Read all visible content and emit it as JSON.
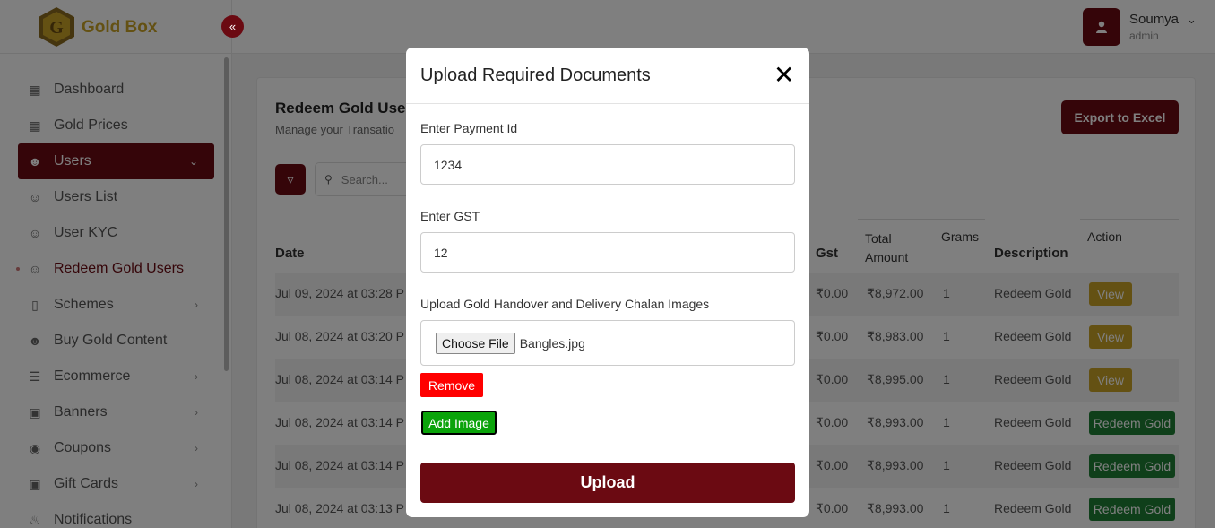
{
  "brand": {
    "name": "Gold Box",
    "logo_letter": "G"
  },
  "sidebar": {
    "items": [
      {
        "label": "Dashboard",
        "icon": "grid-icon"
      },
      {
        "label": "Gold Prices",
        "icon": "grid-icon"
      },
      {
        "label": "Users",
        "icon": "users-icon",
        "active": true
      },
      {
        "label": "Users List",
        "icon": "user-check-icon"
      },
      {
        "label": "User KYC",
        "icon": "user-plus-icon"
      },
      {
        "label": "Redeem Gold Users",
        "icon": "user-minus-icon",
        "current": true
      },
      {
        "label": "Schemes",
        "icon": "phone-icon"
      },
      {
        "label": "Buy Gold Content",
        "icon": "users-icon"
      },
      {
        "label": "Ecommerce",
        "icon": "layers-icon"
      },
      {
        "label": "Banners",
        "icon": "image-icon"
      },
      {
        "label": "Coupons",
        "icon": "eye-icon"
      },
      {
        "label": "Gift Cards",
        "icon": "gift-icon"
      },
      {
        "label": "Notifications",
        "icon": "bell-icon"
      }
    ]
  },
  "user": {
    "name": "Soumya",
    "role": "admin"
  },
  "page": {
    "title": "Redeem Gold Use",
    "subtitle": "Manage your Transatio",
    "export_label": "Export to Excel",
    "search_placeholder": "Search..."
  },
  "table": {
    "headers": {
      "date": "Date",
      "gst": "Gst",
      "total_line1": "Total",
      "total_line2": "Amount",
      "grams": "Grams",
      "description": "Description",
      "action": "Action"
    },
    "rows": [
      {
        "date": "Jul 09, 2024 at 03:28 P",
        "gst": "₹0.00",
        "total": "₹8,972.00",
        "grams": "1",
        "description": "Redeem Gold",
        "action": "View"
      },
      {
        "date": "Jul 08, 2024 at 03:20 P",
        "gst": "₹0.00",
        "total": "₹8,983.00",
        "grams": "1",
        "description": "Redeem Gold",
        "action": "View"
      },
      {
        "date": "Jul 08, 2024 at 03:14 P",
        "gst": "₹0.00",
        "total": "₹8,995.00",
        "grams": "1",
        "description": "Redeem Gold",
        "action": "View"
      },
      {
        "date": "Jul 08, 2024 at 03:14 P",
        "gst": "₹0.00",
        "total": "₹8,993.00",
        "grams": "1",
        "description": "Redeem Gold",
        "action": "Redeem Gold"
      },
      {
        "date": "Jul 08, 2024 at 03:14 P",
        "gst": "₹0.00",
        "total": "₹8,993.00",
        "grams": "1",
        "description": "Redeem Gold",
        "action": "Redeem Gold"
      },
      {
        "date": "Jul 08, 2024 at 03:13 P",
        "gst": "₹0.00",
        "total": "₹8,993.00",
        "grams": "1",
        "description": "Redeem Gold",
        "action": "Redeem Gold"
      }
    ]
  },
  "modal": {
    "title": "Upload Required Documents",
    "payment_label": "Enter Payment Id",
    "payment_value": "1234",
    "gst_label": "Enter GST",
    "gst_value": "12",
    "images_label": "Upload Gold Handover and Delivery Chalan Images",
    "choose_label": "Choose File",
    "file_name": "Bangles.jpg",
    "remove_label": "Remove",
    "add_label": "Add Image",
    "upload_label": "Upload"
  },
  "colors": {
    "primary": "#6b0a12",
    "gold": "#c9a227",
    "success": "#1e7e34",
    "danger": "#ff0000",
    "add": "#0aa30a"
  }
}
